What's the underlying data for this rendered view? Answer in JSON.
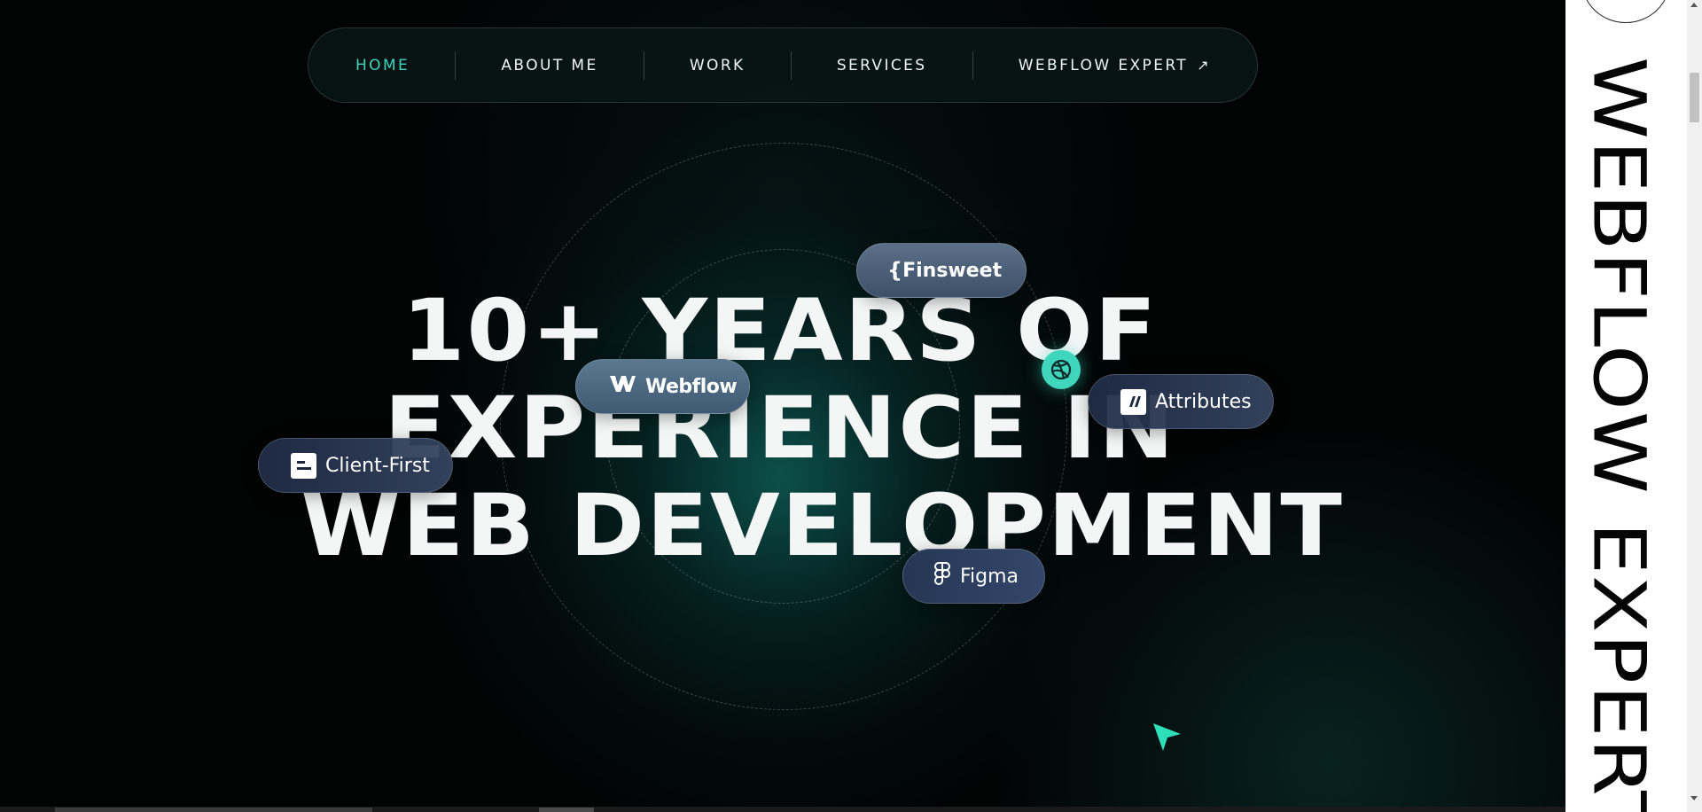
{
  "nav": {
    "items": [
      {
        "label": "HOME",
        "active": true
      },
      {
        "label": "ABOUT ME",
        "active": false
      },
      {
        "label": "WORK",
        "active": false
      },
      {
        "label": "SERVICES",
        "active": false
      },
      {
        "label": "WEBFLOW EXPERT",
        "active": false,
        "icon": "arrow-up-right-icon",
        "icon_glyph": "↗"
      }
    ]
  },
  "hero": {
    "headline": [
      "10+  YEARS OF",
      "EXPERIENCE IN",
      "WEB DEVELOPMENT"
    ]
  },
  "pills": {
    "finsweet": {
      "icon_glyph": "{",
      "label": "Finsweet"
    },
    "webflow": {
      "label": "Webflow"
    },
    "attributes": {
      "label": "Attributes"
    },
    "client_first": {
      "label": "Client-First"
    },
    "figma": {
      "label": "Figma"
    }
  },
  "sidebar": {
    "vertical_text": "WEBFLOW EXPERT"
  },
  "colors": {
    "accent": "#3fd6bd",
    "background": "#020404",
    "text": "#f4f6f6",
    "sidebar_bg": "#ffffff"
  }
}
